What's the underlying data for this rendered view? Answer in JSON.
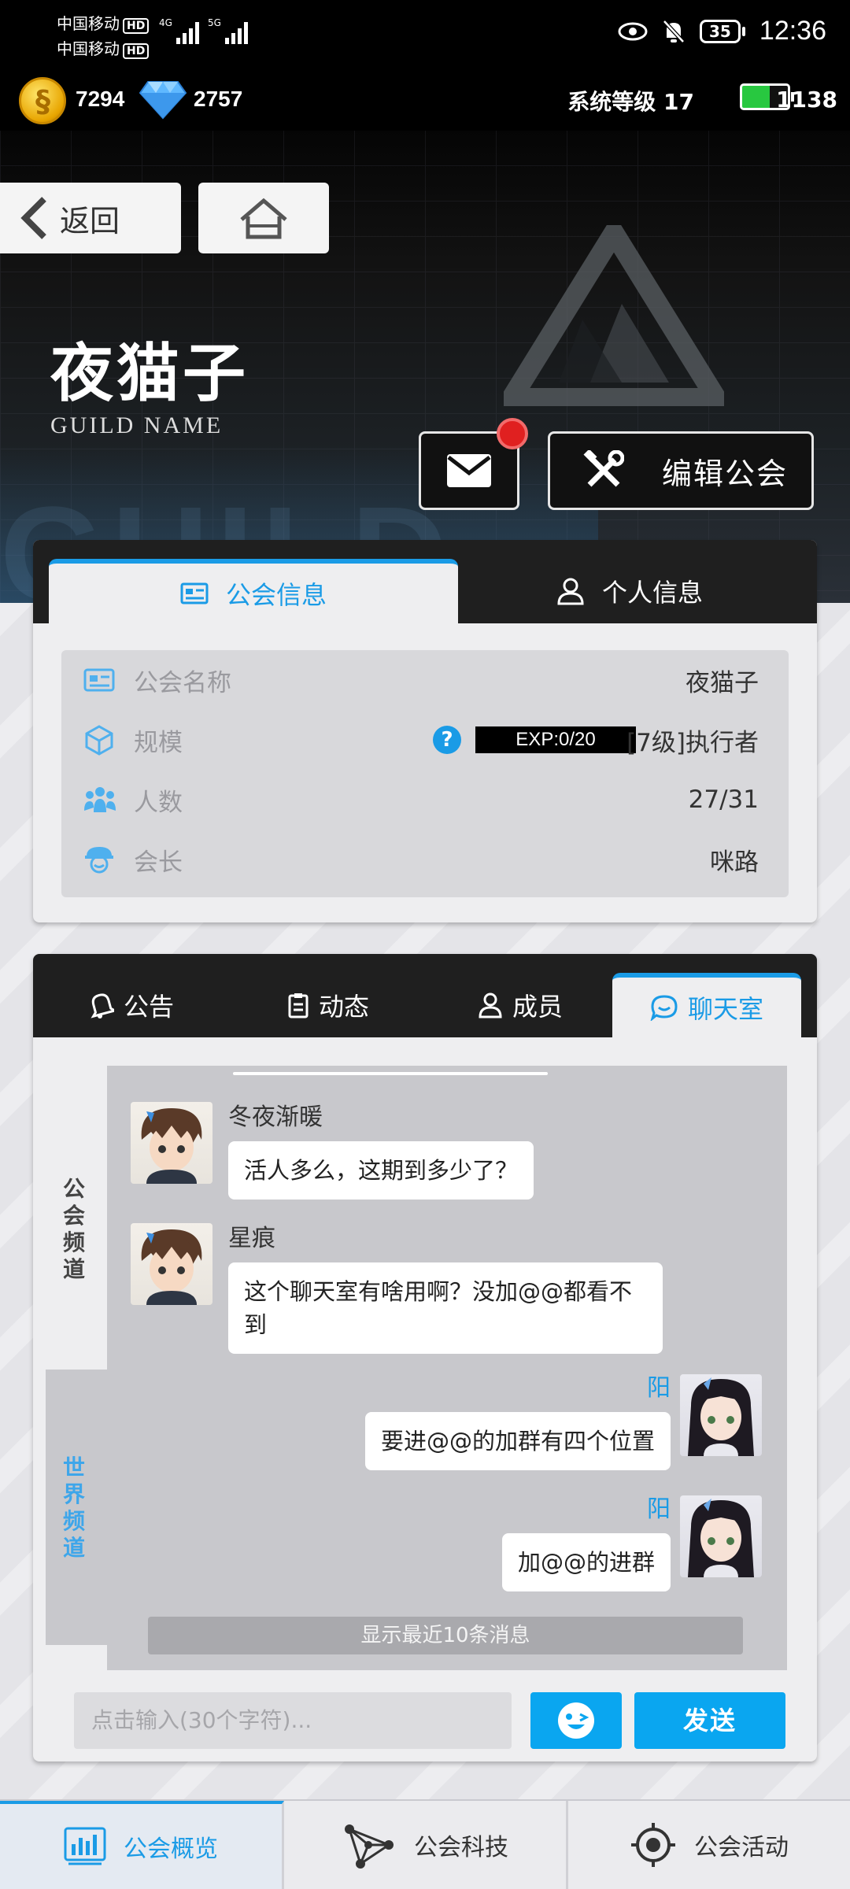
{
  "status_bar": {
    "carrier1": "中国移动",
    "carrier2": "中国移动",
    "hd": "HD",
    "net1": "4G",
    "net2": "5G",
    "battery": "35",
    "time": "12:36"
  },
  "resources": {
    "gold": "7294",
    "diamond": "2757",
    "system_level": "系统等级 17",
    "energy": "1138"
  },
  "header": {
    "back_label": "返回",
    "guild_name": "夜猫子",
    "guild_subtitle": "GUILD NAME",
    "edit_label": "编辑公会"
  },
  "info_tabs": {
    "guild_info": "公会信息",
    "personal_info": "个人信息"
  },
  "info_rows": [
    {
      "key": "公会名称",
      "value": "夜猫子"
    },
    {
      "key": "规模",
      "exp": "EXP:0/20",
      "value": "[7级]执行者"
    },
    {
      "key": "人数",
      "value": "27/31"
    },
    {
      "key": "会长",
      "value": "咪路"
    }
  ],
  "chat_tabs": {
    "notice": "公告",
    "activity": "动态",
    "members": "成员",
    "chatroom": "聊天室"
  },
  "channels": {
    "guild": "公会频道",
    "world": "世界频道"
  },
  "messages": [
    {
      "sender": "冬夜渐暖",
      "text": "活人多么，这期到多少了？",
      "mine": false
    },
    {
      "sender": "星痕",
      "text": "这个聊天室有啥用啊？没加@@都看不到",
      "mine": false
    },
    {
      "sender": "阳",
      "text": "要进@@的加群有四个位置",
      "mine": true
    },
    {
      "sender": "阳",
      "text": "加@@的进群",
      "mine": true
    }
  ],
  "recent_notice": "显示最近10条消息",
  "input": {
    "placeholder": "点击输入(30个字符)...",
    "send_label": "发送"
  },
  "bottom_nav": [
    {
      "label": "公会概览",
      "active": true,
      "icon": "chart-icon"
    },
    {
      "label": "公会科技",
      "active": false,
      "icon": "network-icon"
    },
    {
      "label": "公会活动",
      "active": false,
      "icon": "target-icon"
    }
  ],
  "colors": {
    "accent": "#1a9be6",
    "send_button": "#0aa6f0",
    "notification": "#e02020"
  }
}
